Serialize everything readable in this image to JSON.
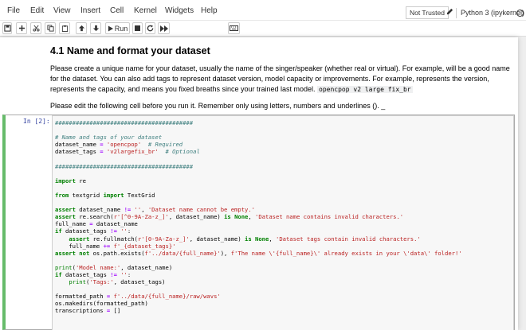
{
  "menubar": {
    "items": [
      "File",
      "Edit",
      "View",
      "Insert",
      "Cell",
      "Kernel",
      "Widgets",
      "Help"
    ],
    "trusted": "Not Trusted",
    "kernel": "Python 3 (ipykernel)"
  },
  "toolbar": {
    "run_label": "Run",
    "cell_type": "Code"
  },
  "markdown": {
    "heading": "4.1 Name and format your dataset",
    "para1": "Please create a unique name for your dataset, usually the name of the singer/speaker (whether real or virtual). For example, will be a good name for the dataset. You can also add tags to represent dataset version, model capacity or improvements. For example, represents the version, represents the capacity, and means you fixed breaths since your trained last model.",
    "para1_code": "opencpop  v2  large  fix_br",
    "para2": "Please edit the following cell before you run it. Remember only using letters, numbers and underlines ()."
  },
  "code_cell": {
    "prompt": "In  [2]:",
    "lines": [
      "########################################",
      "",
      "# Name and tags of your dataset",
      "dataset_name = 'opencpop'  # Required",
      "dataset_tags = 'v2largefix_br'  # Optional",
      "",
      "########################################",
      "",
      "import re",
      "",
      "from textgrid import TextGrid",
      "",
      "assert dataset_name != '', 'Dataset name cannot be empty.'",
      "assert re.search(r'[^0-9A-Za-z_]', dataset_name) is None, 'Dataset name contains invalid characters.'",
      "full_name = dataset_name",
      "if dataset_tags != '':",
      "    assert re.fullmatch(r'[0-9A-Za-z_]', dataset_name) is None, 'Dataset tags contain invalid characters.'",
      "    full_name += f'_{dataset_tags}'",
      "assert not os.path.exists(f'../data/{full_name}'), f'The name \\'{full_name}\\' already exists in your \\'data\\' folder!'",
      "",
      "print('Model name:', dataset_name)",
      "if dataset_tags != '':",
      "    print('Tags:', dataset_tags)",
      "",
      "formatted_path = f'../data/{full_name}/raw/wavs'",
      "os.makedirs(formatted_path)",
      "transcriptions = []"
    ]
  }
}
